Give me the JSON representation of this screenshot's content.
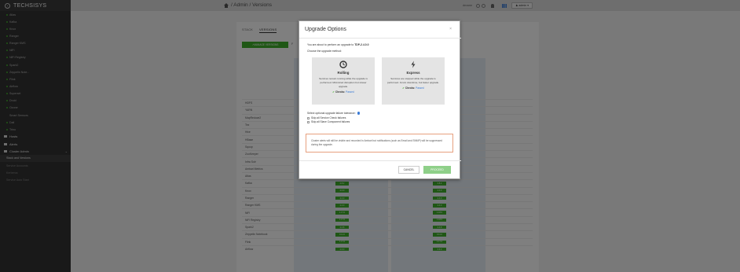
{
  "app": {
    "logo_text": "TECHSISYS"
  },
  "sidebar": {
    "services": [
      {
        "label": "Atlas",
        "status": "green"
      },
      {
        "label": "Kafka",
        "status": "green"
      },
      {
        "label": "Knox",
        "status": "green"
      },
      {
        "label": "Ranger",
        "status": "green"
      },
      {
        "label": "Ranger KMS",
        "status": "green"
      },
      {
        "label": "NiFi",
        "status": "green"
      },
      {
        "label": "NiFi Registry",
        "status": "green"
      },
      {
        "label": "Spark2",
        "status": "green"
      },
      {
        "label": "Zeppelin Note...",
        "status": "green"
      },
      {
        "label": "Flink",
        "status": "green"
      },
      {
        "label": "Airflow",
        "status": "green"
      },
      {
        "label": "Superset",
        "status": "green"
      },
      {
        "label": "Druid",
        "status": "green"
      },
      {
        "label": "Ozone",
        "status": "green"
      },
      {
        "label": "Smart Sensors",
        "status": "none"
      },
      {
        "label": "Dali",
        "status": "green"
      },
      {
        "label": "Trino",
        "status": "green"
      }
    ],
    "sections": [
      {
        "label": "Hosts"
      },
      {
        "label": "Alerts"
      },
      {
        "label": "Cluster Admin"
      }
    ],
    "admin_items": [
      {
        "label": "Stack and Versions"
      },
      {
        "label": "Service Accounts"
      },
      {
        "label": "Kerberos"
      },
      {
        "label": "Service Auto Start"
      }
    ]
  },
  "topbar": {
    "breadcrumb": "/ Admin / Versions",
    "cluster_name": "devarre",
    "user_label": "admin"
  },
  "page": {
    "tabs": [
      "STACK",
      "VERSIONS"
    ],
    "manage_label": "MANAGE VERSIONS",
    "partial_label": "F",
    "services": [
      {
        "name": "HDFS",
        "v1": "",
        "v2": ""
      },
      {
        "name": "YARN",
        "v1": "",
        "v2": ""
      },
      {
        "name": "MapReduce2",
        "v1": "",
        "v2": ""
      },
      {
        "name": "Tez",
        "v1": "",
        "v2": ""
      },
      {
        "name": "Hive",
        "v1": "",
        "v2": ""
      },
      {
        "name": "HBase",
        "v1": "",
        "v2": ""
      },
      {
        "name": "Sqoop",
        "v1": "",
        "v2": ""
      },
      {
        "name": "ZooKeeper",
        "v1": "",
        "v2": ""
      },
      {
        "name": "Infra Solr",
        "v1": "",
        "v2": ""
      },
      {
        "name": "Ambari Metrics",
        "v1": "",
        "v2": ""
      },
      {
        "name": "Atlas",
        "v1": "2.3.0",
        "v2": "2.4.0"
      },
      {
        "name": "Kafka",
        "v1": "2.8.2",
        "v2": "2.8.2"
      },
      {
        "name": "Knox",
        "v1": "2.0.0",
        "v2": "2.0.0"
      },
      {
        "name": "Ranger",
        "v1": "2.4.0",
        "v2": "2.4.0"
      },
      {
        "name": "Ranger KMS",
        "v1": "2.4.0",
        "v2": "2.4.0"
      },
      {
        "name": "NiFi",
        "v1": "1.17.0",
        "v2": "1.18.0"
      },
      {
        "name": "NiFi Registry",
        "v1": "1.17.0",
        "v2": "1.18.0"
      },
      {
        "name": "Spark2",
        "v1": "2.4.8",
        "v2": "2.4.8"
      },
      {
        "name": "Zeppelin Notebook",
        "v1": "0.11.0",
        "v2": "0.11.0"
      },
      {
        "name": "Flink",
        "v1": "1.17.0",
        "v2": "1.17.0"
      },
      {
        "name": "Airflow",
        "v1": "2.6.0",
        "v2": "2.6.0"
      }
    ]
  },
  "modal": {
    "title": "Upgrade Options",
    "close": "×",
    "intro_prefix": "You are about to perform an upgrade to ",
    "intro_target": "TDP-2.4.0.0",
    "choose": "Choose the upgrade method:",
    "rolling": {
      "title": "Rolling",
      "desc": "Services remain running while the upgrade is performed. Minimized disruption but slower upgrade.",
      "checks_label": "Checks:",
      "checks_status": "Passed"
    },
    "express": {
      "title": "Express",
      "desc": "Services are stopped while the upgrade is performed. Incurs downtime, but faster upgrade.",
      "checks_label": "Checks:",
      "checks_status": "Passed"
    },
    "tolerance_title": "Select optional upgrade failure tolerance:",
    "skip_service": "Skip all Service Check failures",
    "skip_slave": "Skip all Slave Component failures",
    "alert_text": "Cluster alerts will still be visible and recorded in Ambari but notifications (such as Email and SNMP) will be suppressed during the upgrade.",
    "cancel_label": "CANCEL",
    "proceed_label": "PROCEED"
  },
  "colors": {
    "accent_green": "#3fae2a",
    "link_blue": "#3a7bd5",
    "alert_border": "#e7a07f"
  }
}
